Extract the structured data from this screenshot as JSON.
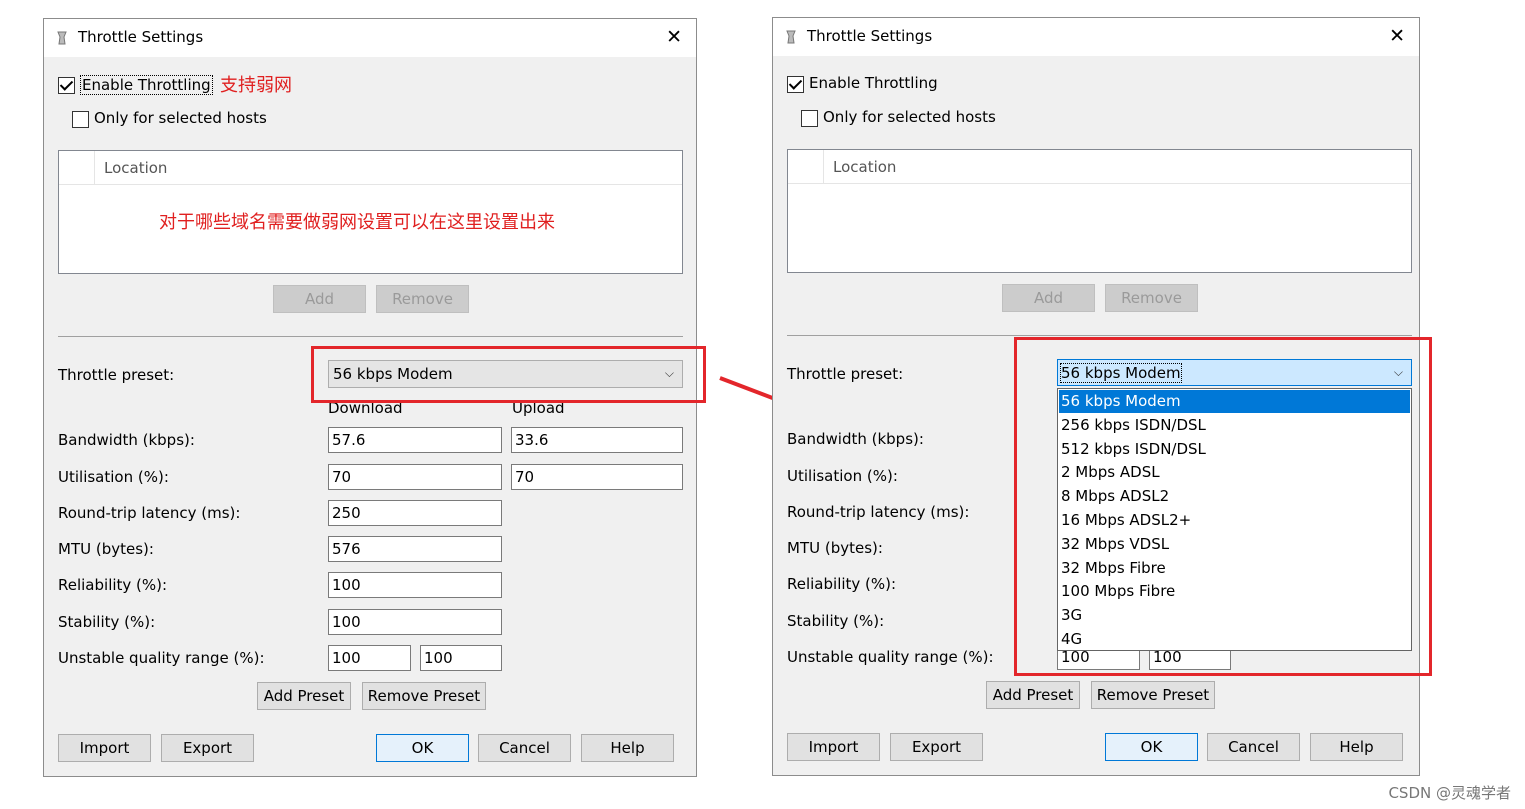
{
  "left_dialog": {
    "title": "Throttle Settings",
    "close": "✕",
    "enable_throttling": "Enable Throttling",
    "only_selected_hosts": "Only for selected hosts",
    "location_header": "Location",
    "add": "Add",
    "remove": "Remove",
    "preset_label": "Throttle preset:",
    "preset_value": "56 kbps Modem",
    "download": "Download",
    "upload": "Upload",
    "bandwidth_label": "Bandwidth (kbps):",
    "bandwidth_down": "57.6",
    "bandwidth_up": "33.6",
    "utilisation_label": "Utilisation (%):",
    "utilisation_down": "70",
    "utilisation_up": "70",
    "latency_label": "Round-trip latency (ms):",
    "latency": "250",
    "mtu_label": "MTU (bytes):",
    "mtu": "576",
    "reliability_label": "Reliability (%):",
    "reliability": "100",
    "stability_label": "Stability (%):",
    "stability": "100",
    "unstable_label": "Unstable quality range (%):",
    "unstable_min": "100",
    "unstable_max": "100",
    "add_preset": "Add Preset",
    "remove_preset": "Remove Preset",
    "import": "Import",
    "export": "Export",
    "ok": "OK",
    "cancel": "Cancel",
    "help": "Help"
  },
  "annotations": {
    "weak_network": "支持弱网",
    "domain_note": "对于哪些域名需要做弱网设置可以在这里设置出来"
  },
  "right_dialog": {
    "title": "Throttle Settings",
    "close": "✕",
    "enable_throttling": "Enable Throttling",
    "only_selected_hosts": "Only for selected hosts",
    "location_header": "Location",
    "add": "Add",
    "remove": "Remove",
    "preset_label": "Throttle preset:",
    "preset_value": "56 kbps Modem",
    "bandwidth_label": "Bandwidth (kbps):",
    "utilisation_label": "Utilisation (%):",
    "latency_label": "Round-trip latency (ms):",
    "mtu_label": "MTU (bytes):",
    "reliability_label": "Reliability (%):",
    "stability_label": "Stability (%):",
    "unstable_label": "Unstable quality range (%):",
    "unstable_min": "100",
    "unstable_max": "100",
    "add_preset": "Add Preset",
    "remove_preset": "Remove Preset",
    "import": "Import",
    "export": "Export",
    "ok": "OK",
    "cancel": "Cancel",
    "help": "Help",
    "preset_options": [
      "56 kbps Modem",
      "256 kbps ISDN/DSL",
      "512 kbps ISDN/DSL",
      "2 Mbps ADSL",
      "8 Mbps ADSL2",
      "16 Mbps ADSL2+",
      "32 Mbps VDSL",
      "32 Mbps Fibre",
      "100 Mbps Fibre",
      "3G",
      "4G"
    ],
    "selected_option": "56 kbps Modem"
  },
  "watermark": "CSDN @灵魂学者",
  "colors": {
    "highlight_red": "#e3262b",
    "annotation_red": "#e02020",
    "selection_blue": "#0078d7"
  }
}
